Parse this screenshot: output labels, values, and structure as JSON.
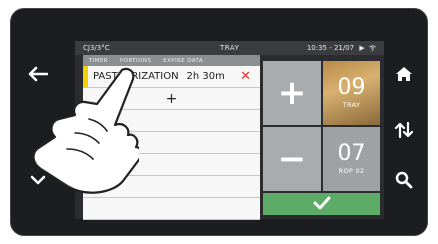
{
  "status_bar": {
    "temperature": "CJ3/3°C",
    "title": "TRAY",
    "time": "10:35 - 21/07"
  },
  "tabs": [
    {
      "label": "TIMER"
    },
    {
      "label": "PORTIONS"
    },
    {
      "label": "EXPIRE DATA"
    }
  ],
  "program": {
    "name": "PASTEURIZATION",
    "time": "2h 30m"
  },
  "add_label": "+",
  "controls": {
    "plus_label": "+",
    "minus_label": "−",
    "tray": {
      "value": "09",
      "label": "TRAY"
    },
    "rop": {
      "value": "07",
      "label": "ROP 02"
    }
  },
  "side_icons": {
    "left": [
      "back-arrow-icon",
      "chevron-down-icon"
    ],
    "right": [
      "home-icon",
      "sort-arrows-icon",
      "search-icon"
    ]
  }
}
